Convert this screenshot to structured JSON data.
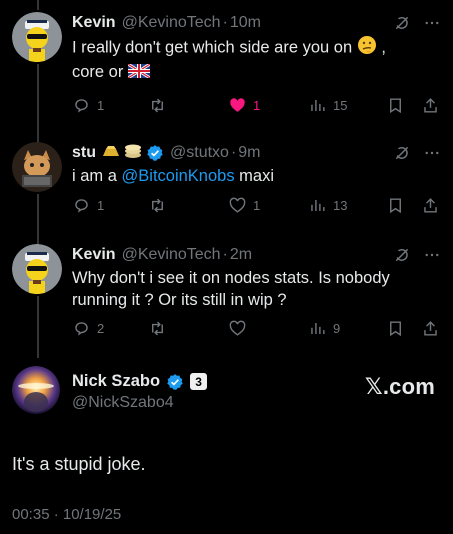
{
  "replies": [
    {
      "name": "Kevin",
      "handle": "@KevinoTech",
      "time": "10m",
      "text_line1": "I really don't get which side are you on",
      "text_comma": ",",
      "text_line2": "core or",
      "replies": "1",
      "retweets": "",
      "likes": "1",
      "views": "15",
      "liked": true
    },
    {
      "name": "stu",
      "handle": "@stutxo",
      "time": "9m",
      "text_prefix": "i am a ",
      "mention": "@BitcoinKnobs",
      "text_suffix": " maxi",
      "replies": "1",
      "retweets": "",
      "likes": "1",
      "views": "13"
    },
    {
      "name": "Kevin",
      "handle": "@KevinoTech",
      "time": "2m",
      "text_line1": "Why don't i see it on nodes stats. Is nobody",
      "text_line2": "running it ? Or its still in wip ?",
      "replies": "2",
      "retweets": "",
      "likes": "",
      "views": "9"
    }
  ],
  "main": {
    "name": "Nick Szabo",
    "badge_number": "3",
    "handle": "@NickSzabo4",
    "text": "It's a stupid joke.",
    "timestamp": "00:35 · 10/19/25",
    "watermark": "𝕏.com"
  },
  "colors": {
    "background": "#000000",
    "text": "#e7e9ea",
    "secondary": "#71767b",
    "link": "#1d9bf0",
    "like": "#f91880"
  }
}
